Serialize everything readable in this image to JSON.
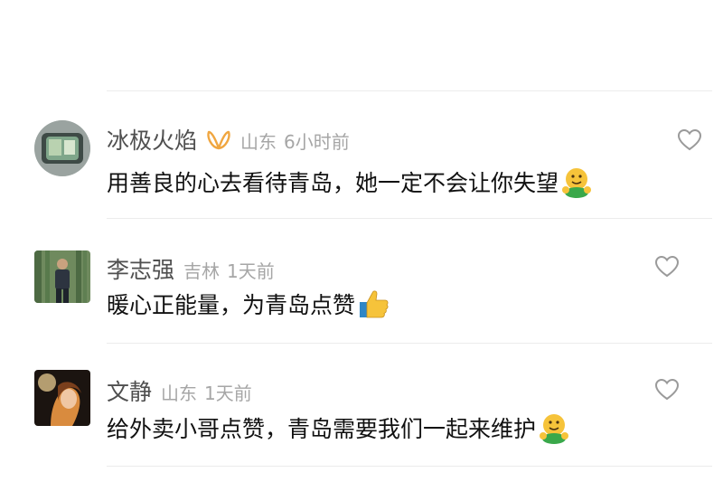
{
  "comments": [
    {
      "username": "冰极火焰",
      "location": "山东",
      "time": "6小时前",
      "text": "用善良的心去看待青岛，她一定不会让你失望",
      "emoji": "hugging-face-emoji",
      "badge": "vip-badge-icon"
    },
    {
      "username": "李志强",
      "location": "吉林",
      "time": "1天前",
      "text": "暖心正能量，为青岛点赞",
      "emoji": "thumbs-up-emoji"
    },
    {
      "username": "文静",
      "location": "山东",
      "time": "1天前",
      "text": "给外卖小哥点赞，青岛需要我们一起来维护",
      "emoji": "hugging-face-emoji"
    }
  ],
  "colors": {
    "username": "#4f4f4f",
    "meta": "#a6a6a6",
    "text": "#111111",
    "badge": "#f0a640",
    "divider": "#ececec"
  }
}
